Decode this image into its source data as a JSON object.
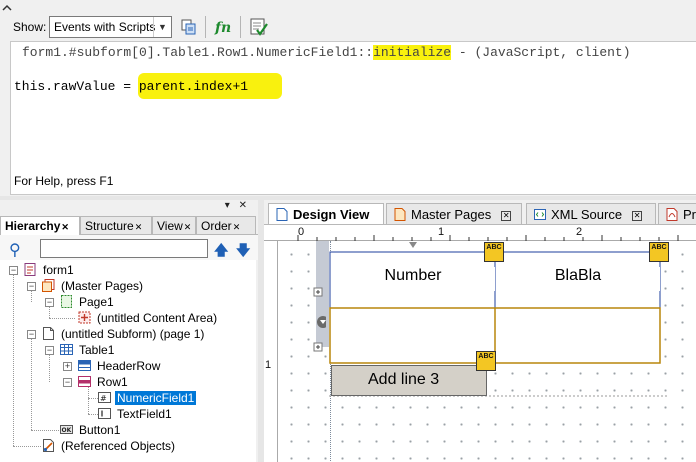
{
  "toolbar": {
    "show_label": "Show:",
    "show_select_value": "Events with Scripts"
  },
  "script": {
    "line1": "form1.#subform[0].Table1.Row1.NumericField1",
    "event_sep": "::",
    "event": "initialize",
    "line1_tail": " - (JavaScript, client)",
    "code_prefix": "this.rawValue = ",
    "code_value": "parent.index+1"
  },
  "status": {
    "text": "For Help, press F1"
  },
  "hierarchy": {
    "tabs": [
      {
        "label": "Hierarchy"
      },
      {
        "label": "Structure"
      },
      {
        "label": "View"
      },
      {
        "label": "Order"
      }
    ],
    "tree": [
      {
        "label": "form1"
      },
      {
        "label": "(Master Pages)"
      },
      {
        "label": "Page1"
      },
      {
        "label": "(untitled Content Area)"
      },
      {
        "label": "(untitled Subform) (page 1)"
      },
      {
        "label": "Table1"
      },
      {
        "label": "HeaderRow"
      },
      {
        "label": "Row1"
      },
      {
        "label": "NumericField1"
      },
      {
        "label": "TextField1"
      },
      {
        "label": "Button1"
      },
      {
        "label": "(Referenced Objects)"
      }
    ]
  },
  "design": {
    "tabs": [
      {
        "label": "Design View"
      },
      {
        "label": "Master Pages"
      },
      {
        "label": "XML Source"
      },
      {
        "label": "Pre"
      }
    ],
    "ruler": {
      "h": [
        "0",
        "1",
        "2"
      ],
      "v": [
        "1"
      ]
    },
    "cells": {
      "header1": "Number",
      "header2": "BlaBla"
    },
    "button_caption": "Add line 3",
    "abc_badge": "ABC"
  }
}
